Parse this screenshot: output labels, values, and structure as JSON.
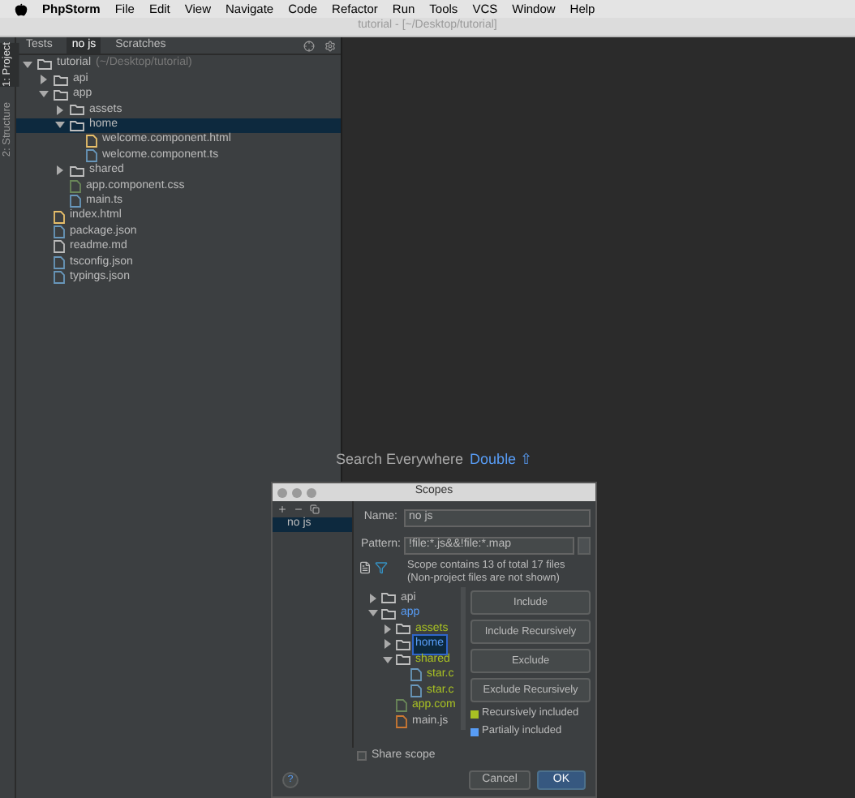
{
  "menubar": {
    "app": "PhpStorm",
    "items": [
      "File",
      "Edit",
      "View",
      "Navigate",
      "Code",
      "Refactor",
      "Run",
      "Tools",
      "VCS",
      "Window",
      "Help"
    ]
  },
  "window": {
    "title": "tutorial - [~/Desktop/tutorial]"
  },
  "side_tabs": [
    {
      "label": "1: Project",
      "selected": true
    },
    {
      "label": "2: Structure",
      "selected": false
    }
  ],
  "project": {
    "tabs": [
      {
        "label": "Tests",
        "selected": false
      },
      {
        "label": "no js",
        "selected": true
      },
      {
        "label": "Scratches",
        "selected": false
      }
    ],
    "tree": [
      {
        "name": "tutorial",
        "path": "(~/Desktop/tutorial)",
        "kind": "folder",
        "expanded": true,
        "selected": false,
        "children": [
          {
            "name": "api",
            "kind": "folder",
            "expanded": false,
            "selected": false
          },
          {
            "name": "app",
            "kind": "folder",
            "expanded": true,
            "selected": false,
            "children": [
              {
                "name": "assets",
                "kind": "folder",
                "expanded": false,
                "selected": false
              },
              {
                "name": "home",
                "kind": "folder",
                "expanded": true,
                "selected": true,
                "children": [
                  {
                    "name": "welcome.component.html",
                    "kind": "html",
                    "selected": false
                  },
                  {
                    "name": "welcome.component.ts",
                    "kind": "ts",
                    "selected": false
                  }
                ]
              },
              {
                "name": "shared",
                "kind": "folder",
                "expanded": false,
                "selected": false
              },
              {
                "name": "app.component.css",
                "kind": "css",
                "selected": false
              },
              {
                "name": "main.ts",
                "kind": "ts",
                "selected": false
              }
            ]
          },
          {
            "name": "index.html",
            "kind": "html",
            "selected": false
          },
          {
            "name": "package.json",
            "kind": "json",
            "selected": false
          },
          {
            "name": "readme.md",
            "kind": "text",
            "selected": false
          },
          {
            "name": "tsconfig.json",
            "kind": "json",
            "selected": false
          },
          {
            "name": "typings.json",
            "kind": "json",
            "selected": false
          }
        ]
      }
    ]
  },
  "editor": {
    "hint": "Search Everywhere",
    "shortcut": "Double ⇧"
  },
  "dialog": {
    "title": "Scopes",
    "scopes": [
      {
        "label": "no js",
        "selected": true
      }
    ],
    "name": {
      "label": "Name:",
      "value": "no js"
    },
    "pattern": {
      "label": "Pattern:",
      "value": "!file:*.js&&!file:*.map"
    },
    "info": [
      "Scope contains 13 of total 17 files",
      "(Non-project files are not shown)"
    ],
    "tree": [
      {
        "name": "api",
        "kind": "folder",
        "expanded": false,
        "selected": false,
        "color": "#bbbbbb"
      },
      {
        "name": "app",
        "kind": "folder",
        "expanded": true,
        "selected": false,
        "color": "#589df6",
        "children": [
          {
            "name": "assets",
            "kind": "folder",
            "expanded": false,
            "selected": false,
            "color": "#a8c023"
          },
          {
            "name": "home",
            "kind": "folder",
            "expanded": false,
            "selected": true,
            "color": "#589df6"
          },
          {
            "name": "shared",
            "kind": "folder",
            "expanded": true,
            "selected": false,
            "color": "#a8c023",
            "children": [
              {
                "name": "star.c",
                "kind": "ts",
                "selected": false,
                "color": "#a8c023"
              },
              {
                "name": "star.c",
                "kind": "ts",
                "selected": false,
                "color": "#a8c023"
              }
            ]
          },
          {
            "name": "app.com",
            "kind": "css",
            "selected": false,
            "color": "#a8c023"
          },
          {
            "name": "main.js",
            "kind": "js",
            "selected": false,
            "color": "#bbbbbb"
          }
        ]
      }
    ],
    "buttons": [
      "Include",
      "Include Recursively",
      "Exclude",
      "Exclude Recursively"
    ],
    "legend": [
      {
        "label": "Recursively included",
        "color": "#a8c023"
      },
      {
        "label": "Partially included",
        "color": "#589df6"
      }
    ],
    "share_scope": {
      "label": "Share scope",
      "checked": false
    },
    "help": "?",
    "cancel": "Cancel",
    "ok": "OK"
  }
}
